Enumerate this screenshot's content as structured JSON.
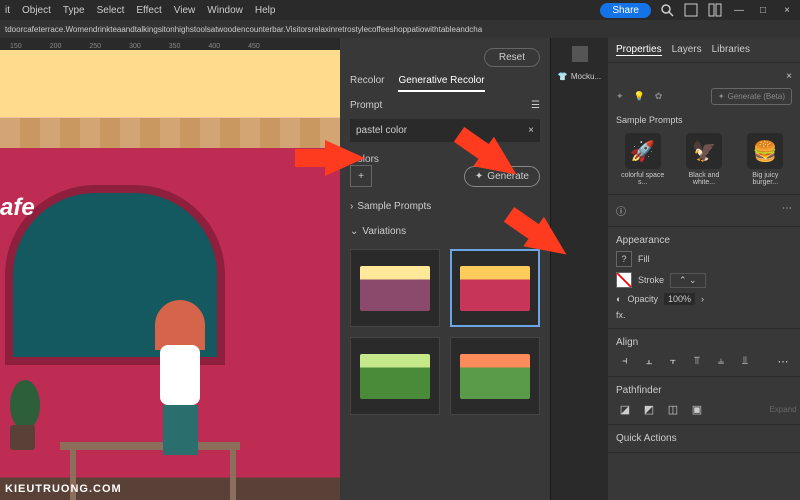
{
  "menubar": {
    "items": [
      "it",
      "Object",
      "Type",
      "Select",
      "Effect",
      "View",
      "Window",
      "Help"
    ],
    "share": "Share"
  },
  "tabbar": {
    "filename": "tdoorcafeterrace.Womendrinkteaandtalkingsitonhighstoolsatwoodencounterbar.Visitorsrelaxinretrostylecoffeeshoppatiowithtableandcha"
  },
  "canvas": {
    "sign": "afe",
    "watermark": "KIEUTRUONG.COM"
  },
  "recolor": {
    "reset": "Reset",
    "tab_recolor": "Recolor",
    "tab_generative": "Generative Recolor",
    "prompt_label": "Prompt",
    "prompt_value": "pastel color",
    "colors_label": "Colors",
    "generate": "Generate",
    "sample_prompts": "Sample Prompts",
    "variations": "Variations"
  },
  "midstrip": {
    "mockup": "Mocku..."
  },
  "properties": {
    "tabs": {
      "properties": "Properties",
      "layers": "Layers",
      "libraries": "Libraries"
    },
    "generate_beta": "Generate (Beta)",
    "sample_prompts": "Sample Prompts",
    "samples": {
      "rocket": "colorful space s...",
      "bird": "Black and white...",
      "burger": "Big juicy burger..."
    },
    "appearance": "Appearance",
    "fill": "Fill",
    "stroke": "Stroke",
    "opacity": "Opacity",
    "opacity_value": "100%",
    "align": "Align",
    "pathfinder": "Pathfinder",
    "expand": "Expand",
    "quick_actions": "Quick Actions"
  }
}
